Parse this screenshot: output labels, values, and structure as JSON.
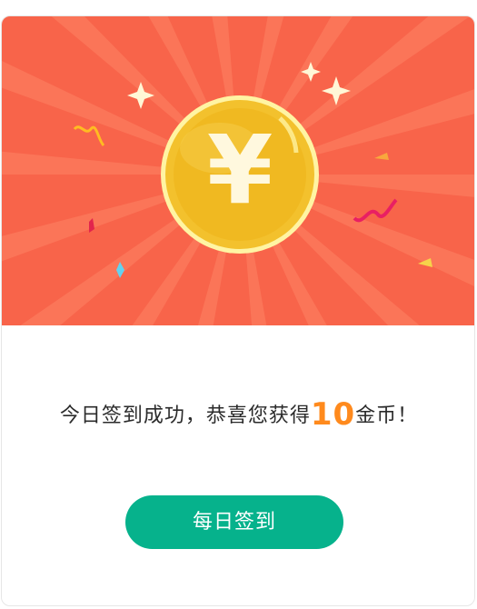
{
  "dialog": {
    "coin_symbol": "¥",
    "message_prefix": "今日签到成功，恭喜您获得",
    "reward_amount": "10",
    "message_suffix": "金币！",
    "button_label": "每日签到"
  },
  "colors": {
    "banner_background": "#f8644a",
    "coin_gold": "#f5c431",
    "reward_orange": "#ff8a1d",
    "button_green": "#06b28c"
  },
  "icons": [
    "coin-icon",
    "sparkle-icon",
    "confetti-icon"
  ]
}
